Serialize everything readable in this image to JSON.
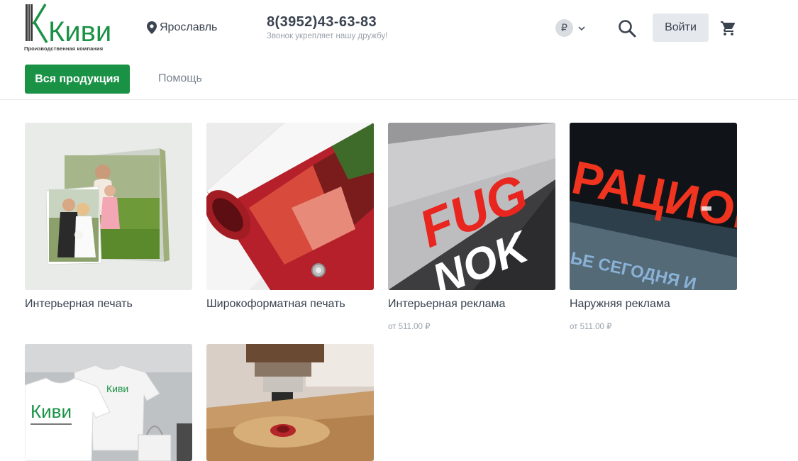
{
  "header": {
    "logo_text": "Киви",
    "logo_tagline": "Производственная компания",
    "city": "Ярославль",
    "phone": "8(3952)43-63-83",
    "phone_slogan": "Звонок укрепляет нашу дружбу!",
    "currency_symbol": "₽",
    "login_label": "Войти"
  },
  "nav": {
    "primary_label": "Вся продукция",
    "secondary_label": "Помощь"
  },
  "colors": {
    "brand_green": "#1a9245",
    "text": "#3a4350",
    "muted": "#9aa2ab"
  },
  "products": [
    {
      "title": "Интерьерная печать",
      "price": ""
    },
    {
      "title": "Широкоформатная печать",
      "price": ""
    },
    {
      "title": "Интерьерная реклама",
      "price": "от 511.00 ₽"
    },
    {
      "title": "Наружняя реклама",
      "price": "от 511.00 ₽"
    },
    {
      "title": "",
      "price": ""
    },
    {
      "title": "",
      "price": ""
    }
  ],
  "images": {
    "signage_indoor_text": "FUG",
    "signage_indoor_text2": "NOK",
    "signage_outdoor_text": "РАЦИОН",
    "signage_outdoor_sub": "ЬЕ  СЕГОДНЯ  И",
    "tshirt_logo": "Киви"
  }
}
